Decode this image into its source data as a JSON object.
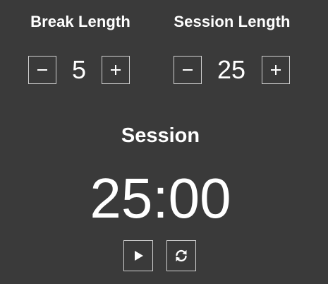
{
  "break_control": {
    "label": "Break Length",
    "value": "5",
    "decrement_icon": "minus-icon",
    "increment_icon": "plus-icon"
  },
  "session_control": {
    "label": "Session Length",
    "value": "25",
    "decrement_icon": "minus-icon",
    "increment_icon": "plus-icon"
  },
  "timer": {
    "label": "Session",
    "time_left": "25:00"
  },
  "transport": {
    "start_stop_icon": "play-icon",
    "reset_icon": "refresh-icon"
  },
  "colors": {
    "background": "#3a3a3a",
    "text": "#ffffff",
    "button_border": "#d0d0d0"
  }
}
